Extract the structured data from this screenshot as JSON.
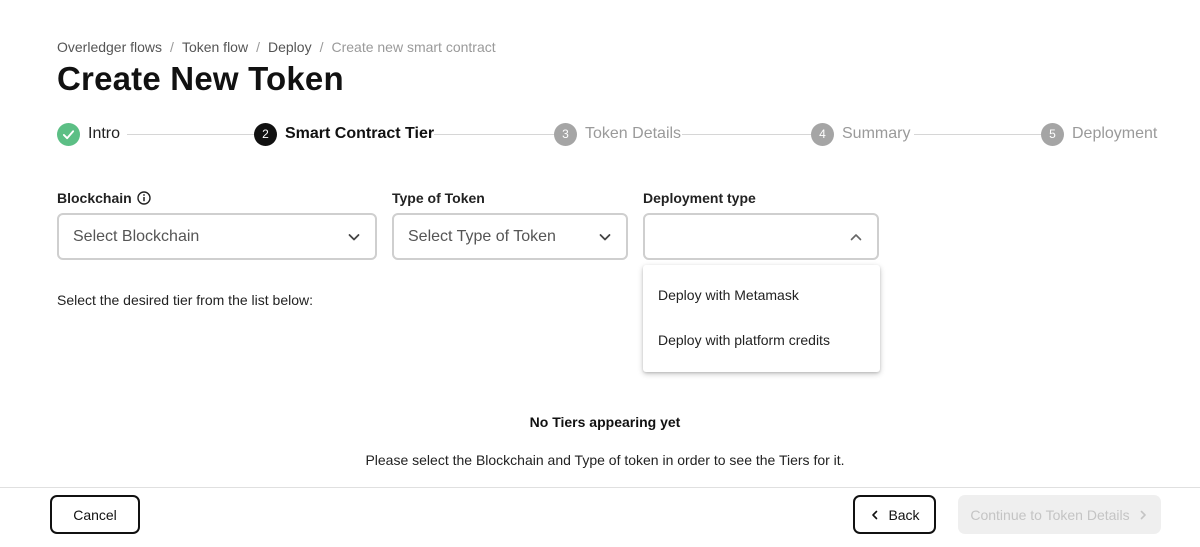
{
  "breadcrumb": {
    "items": [
      "Overledger flows",
      "Token flow",
      "Deploy",
      "Create new smart contract"
    ],
    "separator": "/"
  },
  "page_title": "Create New Token",
  "stepper": {
    "steps": [
      {
        "number": "1",
        "label": "Intro",
        "state": "done"
      },
      {
        "number": "2",
        "label": "Smart Contract Tier",
        "state": "active"
      },
      {
        "number": "3",
        "label": "Token Details",
        "state": "pending"
      },
      {
        "number": "4",
        "label": "Summary",
        "state": "pending"
      },
      {
        "number": "5",
        "label": "Deployment",
        "state": "pending"
      }
    ]
  },
  "form": {
    "blockchain": {
      "label": "Blockchain",
      "value": "Select Blockchain",
      "icon": "info-icon"
    },
    "token_type": {
      "label": "Type of Token",
      "value": "Select Type of Token"
    },
    "deployment_type": {
      "label": "Deployment type",
      "value": "",
      "expanded": true,
      "options": [
        "Deploy with Metamask",
        "Deploy with platform credits"
      ]
    }
  },
  "tiers": {
    "hint": "Select the desired tier from the list below:",
    "empty_title": "No Tiers appearing yet",
    "empty_description": "Please select the Blockchain and Type of token in order to see the Tiers for it."
  },
  "footer": {
    "cancel_label": "Cancel",
    "back_label": "Back",
    "continue_label": "Continue to Token Details"
  },
  "colors": {
    "done": "#5cbf85",
    "active": "#111111",
    "pending": "#a5a5a5",
    "disabled_button_bg": "#efefef"
  }
}
